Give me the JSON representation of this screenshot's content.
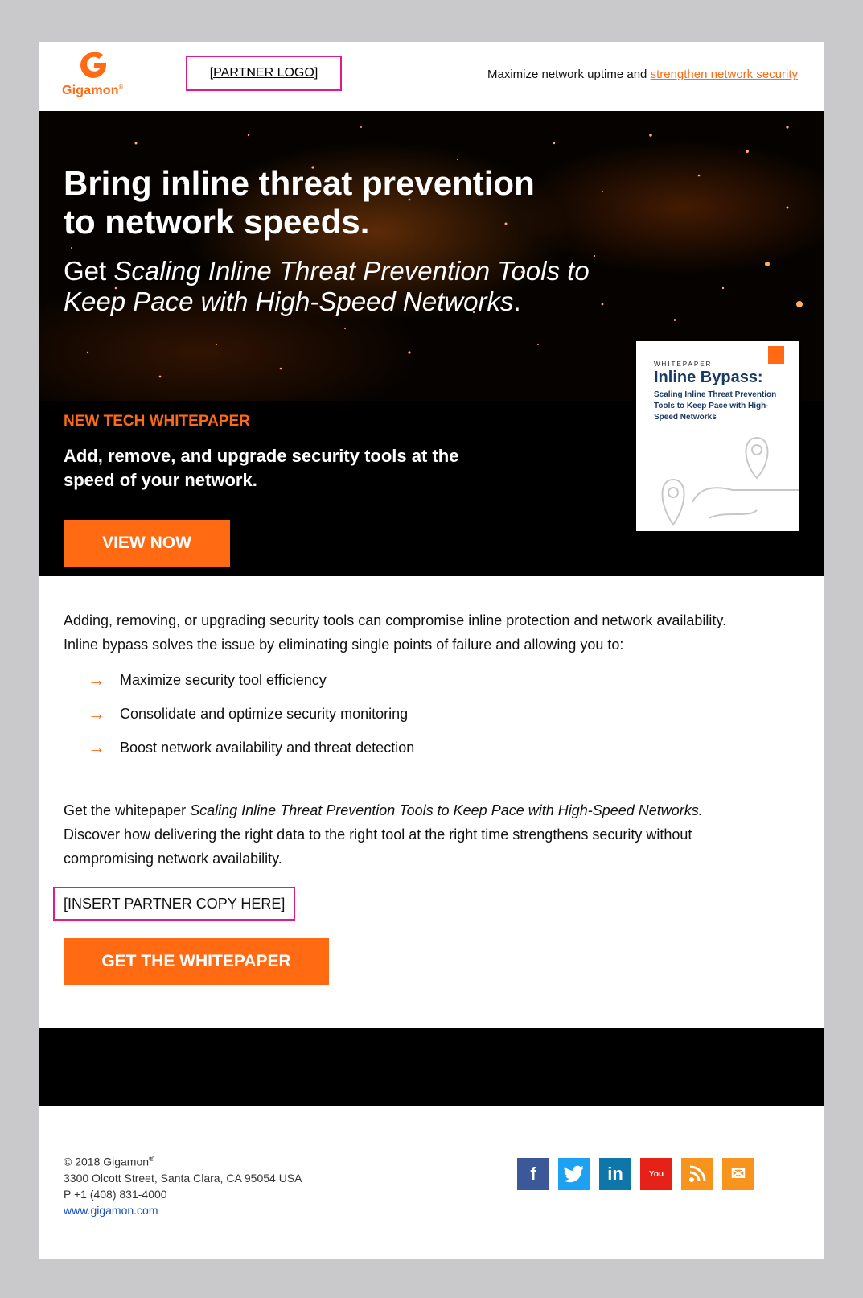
{
  "header": {
    "brand_name": "Gigamon",
    "partner_logo_placeholder": "[PARTNER LOGO]",
    "tagline_prefix": "Maximize network uptime and",
    "tagline_link": "strengthen network security"
  },
  "hero": {
    "headline_line1": "Bring inline threat prevention",
    "headline_line2": "to network speeds.",
    "sub_prefix": "Get",
    "sub_title": "Scaling Inline Threat Prevention Tools to Keep Pace with High-Speed Networks",
    "sub_suffix": ".",
    "label": "NEW TECH WHITEPAPER",
    "description": "Add, remove, and upgrade security tools at the speed of your network.",
    "cta": "VIEW NOW"
  },
  "cover": {
    "kicker": "WHITEPAPER",
    "title": "Inline Bypass:",
    "subtitle": "Scaling Inline Threat Prevention Tools to Keep Pace with High-Speed Networks"
  },
  "body": {
    "intro": "Adding, removing, or upgrading security tools can compromise inline protection and network availability. Inline bypass solves the issue by eliminating single points of failure and allowing you to:",
    "bullets": [
      "Maximize security tool efficiency",
      "Consolidate and optimize security monitoring",
      "Boost network availability and threat detection"
    ],
    "outro_prefix": "Get the whitepaper",
    "outro_title": "Scaling Inline Threat Prevention Tools to Keep Pace with High-Speed Networks.",
    "outro_rest": "Discover how delivering the right data to the right tool at the right time strengthens security without compromising network availability.",
    "partner_copy": "[INSERT PARTNER COPY HERE]",
    "cta": "GET THE WHITEPAPER"
  },
  "footer": {
    "copyright": "© 2018 Gigamon",
    "registered": "®",
    "address": "3300 Olcott Street, Santa Clara, CA 95054 USA",
    "phone": "P +1 (408) 831-4000",
    "website": "www.gigamon.com"
  },
  "social": [
    {
      "name": "facebook-icon",
      "glyph": "f",
      "color": "#3b5998"
    },
    {
      "name": "twitter-icon",
      "glyph": "🐦",
      "color": "#1da1f2"
    },
    {
      "name": "linkedin-icon",
      "glyph": "in",
      "color": "#0e76a8"
    },
    {
      "name": "youtube-icon",
      "glyph": "You",
      "color": "#e62117"
    },
    {
      "name": "rss-icon",
      "glyph": "◠",
      "color": "#f7941d"
    },
    {
      "name": "email-icon",
      "glyph": "✉",
      "color": "#f7941d"
    }
  ],
  "colors": {
    "accent": "#ff6a13",
    "partner_border": "#e1198b",
    "hero_bg": "#000000",
    "page_bg": "#c9c9cb"
  }
}
